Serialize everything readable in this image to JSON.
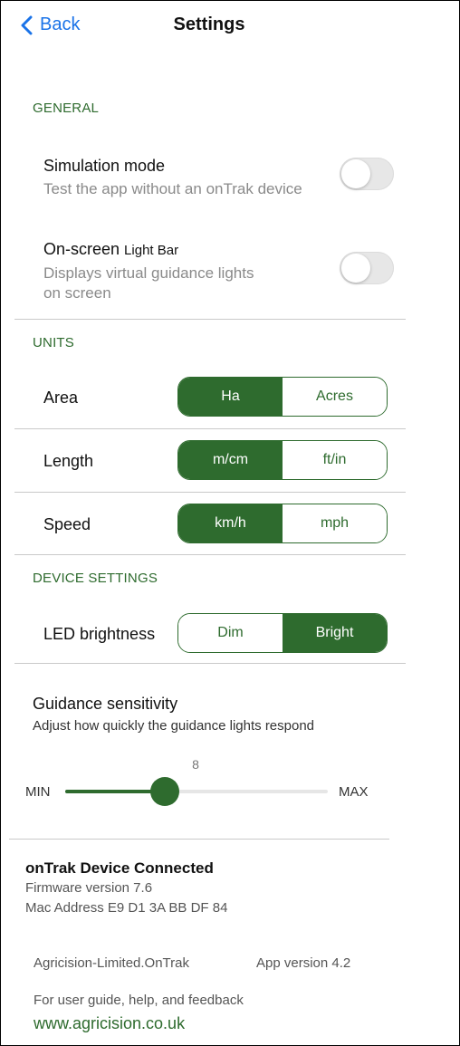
{
  "header": {
    "back_label": "Back",
    "title": "Settings"
  },
  "general": {
    "label": "GENERAL",
    "simulation": {
      "title": "Simulation mode",
      "subtitle": "Test the app without an onTrak device",
      "on": false
    },
    "lightbar": {
      "title_a": "On-screen ",
      "title_b": "Light Bar",
      "subtitle_1": "Displays virtual guidance lights",
      "subtitle_2": "on screen",
      "on": false
    }
  },
  "units": {
    "label": "UNITS",
    "area": {
      "label": "Area",
      "options": [
        "Ha",
        "Acres"
      ],
      "selected": "Ha"
    },
    "length": {
      "label": "Length",
      "options": [
        "m/cm",
        "ft/in"
      ],
      "selected": "m/cm"
    },
    "speed": {
      "label": "Speed",
      "options": [
        "km/h",
        "mph"
      ],
      "selected": "km/h"
    }
  },
  "device": {
    "label": "DEVICE SETTINGS",
    "led": {
      "label": "LED brightness",
      "options": [
        "Dim",
        "Bright"
      ],
      "selected": "Bright"
    }
  },
  "guidance": {
    "title": "Guidance sensitivity",
    "subtitle": "Adjust how quickly the guidance lights respond",
    "value": "8",
    "fraction": 0.38,
    "min_label": "MIN",
    "max_label": "MAX"
  },
  "footer": {
    "connected": "onTrak Device Connected",
    "firmware": "Firmware version 7.6",
    "mac": "Mac Address E9 D1 3A BB DF 84",
    "bundle": "Agricision-Limited.OnTrak",
    "app_version": "App version 4.2",
    "help_text": "For user guide, help, and feedback",
    "website": "www.agricision.co.uk"
  },
  "colors": {
    "accent": "#2e6b2e",
    "link_blue": "#1a73e8"
  }
}
